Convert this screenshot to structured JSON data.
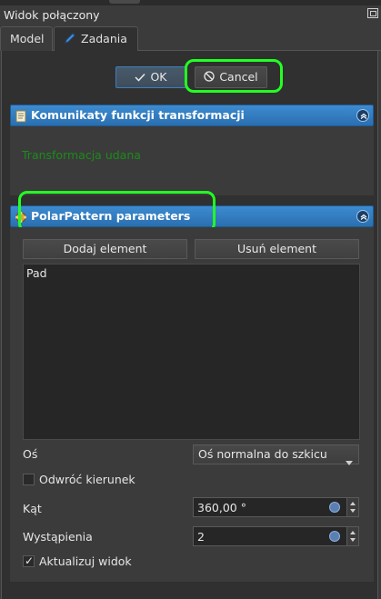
{
  "window": {
    "title": "Widok połączony"
  },
  "tabs": [
    {
      "label": "Model"
    },
    {
      "label": "Zadania"
    }
  ],
  "dialog": {
    "ok_label": "OK",
    "cancel_label": "Cancel"
  },
  "messages_section": {
    "title": "Komunikaty funkcji transformacji",
    "status": "Transformacja udana"
  },
  "pattern_section": {
    "title": "PolarPattern parameters",
    "add_label": "Dodaj element",
    "remove_label": "Usuń element",
    "features": [
      "Pad"
    ],
    "axis_label": "Oś",
    "axis_value": "Oś normalna do szkicu",
    "reverse_label": "Odwróć kierunek",
    "reverse_checked": false,
    "angle_label": "Kąt",
    "angle_value": "360,00 °",
    "occurrences_label": "Wystąpienia",
    "occurrences_value": "2",
    "update_label": "Aktualizuj widok",
    "update_checked": true
  },
  "colors": {
    "accent": "#2f7bc0",
    "highlight": "#22ff22",
    "success_text": "#1a8c1a"
  }
}
